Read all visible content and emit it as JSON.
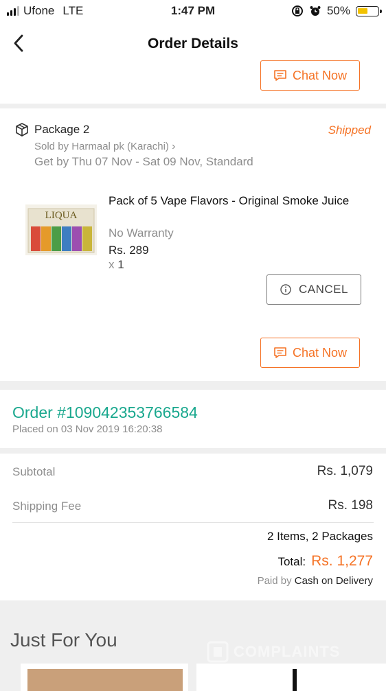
{
  "status_bar": {
    "carrier": "Ufone",
    "network": "LTE",
    "time": "1:47 PM",
    "battery": "50%",
    "battery_level": 0.5
  },
  "nav": {
    "title": "Order Details",
    "back_icon": "chevron-left-icon"
  },
  "previous_package": {
    "chat_label": "Chat Now"
  },
  "package": {
    "title": "Package 2",
    "status": "Shipped",
    "seller": "Sold by Harmaal pk (Karachi)",
    "delivery": "Get by Thu 07 Nov - Sat 09 Nov, Standard",
    "product": {
      "name": "Pack of 5 Vape Flavors - Original Smoke Juice",
      "warranty": "No Warranty",
      "price": "Rs. 289",
      "quantity_prefix": "x",
      "quantity": "1",
      "image_logo_text": "LIQUA"
    },
    "cancel_label": "CANCEL",
    "chat_label": "Chat Now"
  },
  "order": {
    "number": "Order #109042353766584",
    "placed": "Placed on 03 Nov 2019  16:20:38"
  },
  "summary": {
    "subtotal_label": "Subtotal",
    "subtotal_value": "Rs. 1,079",
    "shipping_label": "Shipping Fee",
    "shipping_value": "Rs. 198",
    "items_packages": "2 Items, 2 Packages",
    "total_label": "Total:",
    "total_value": "Rs. 1,277",
    "paid_prefix": "Paid by",
    "paid_method": "Cash on Delivery"
  },
  "just_for_you": {
    "title": "Just For You"
  },
  "watermark": {
    "text": "COMPLAINTS"
  },
  "colors": {
    "accent": "#f57224",
    "order_green": "#1aa88e",
    "muted": "#8e8e8e"
  }
}
